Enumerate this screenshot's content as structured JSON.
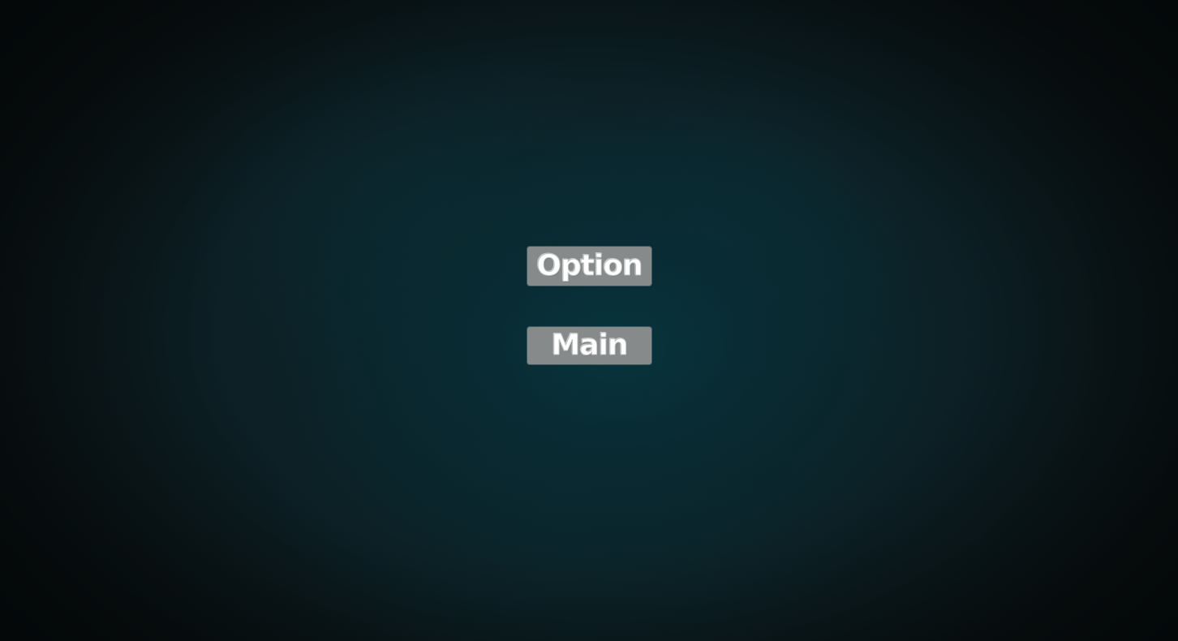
{
  "menu": {
    "buttons": [
      {
        "id": "option",
        "label": "Option"
      },
      {
        "id": "main",
        "label": "Main"
      }
    ]
  },
  "colors": {
    "background_center": "#0b2a31",
    "background_edge": "#080f11",
    "button_fill": "#878a8a",
    "button_text": "#ffffff"
  }
}
